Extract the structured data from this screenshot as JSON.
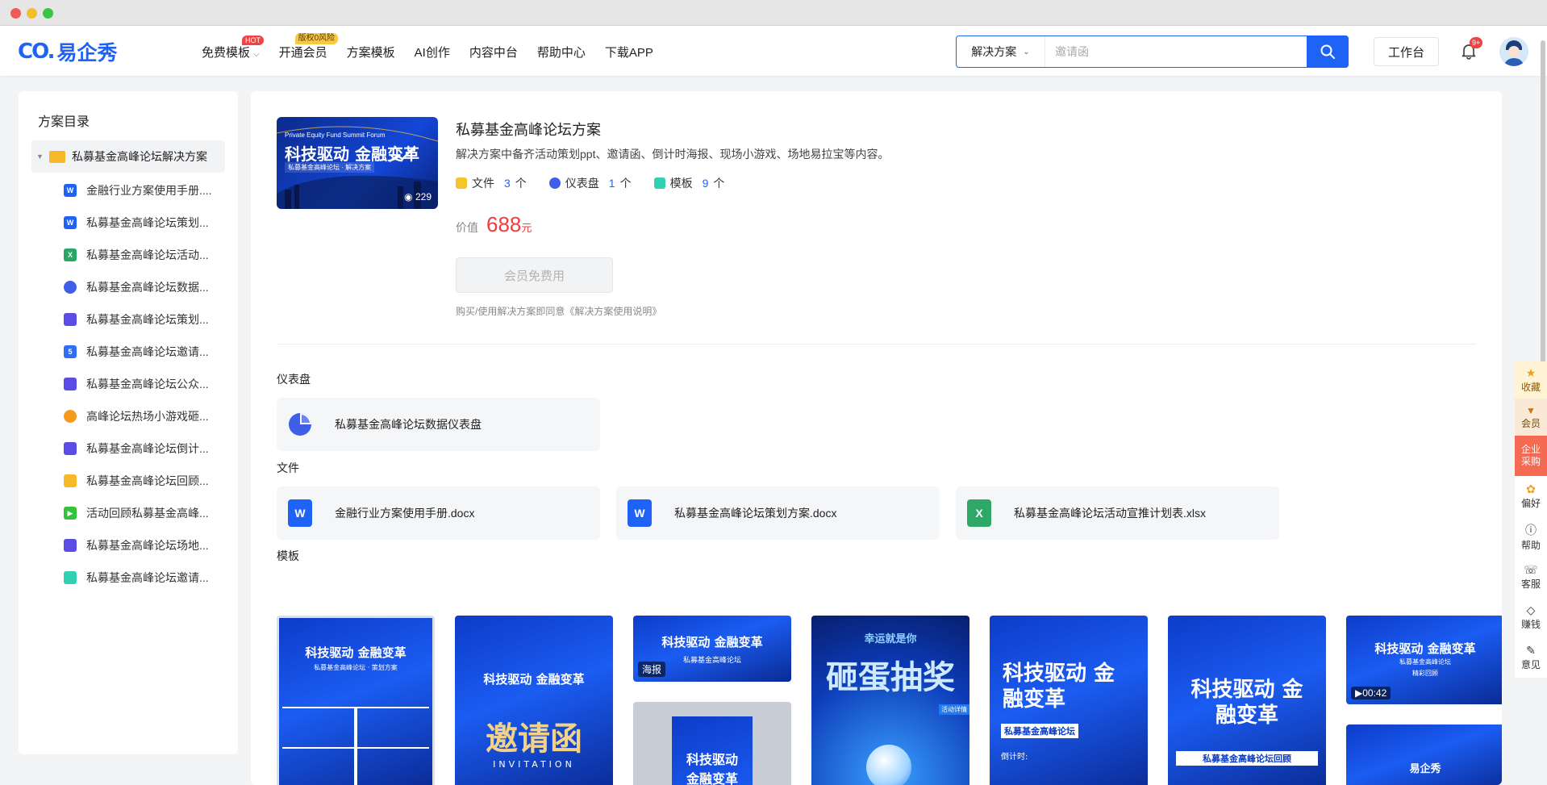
{
  "header": {
    "logo_mark": "CO.",
    "logo_text": "易企秀",
    "nav": [
      {
        "label": "免费模板",
        "badge": "HOT",
        "has_dropdown": true
      },
      {
        "label": "开通会员",
        "badge": "版权0风险"
      },
      {
        "label": "方案模板"
      },
      {
        "label": "AI创作"
      },
      {
        "label": "内容中台"
      },
      {
        "label": "帮助中心"
      },
      {
        "label": "下载APP"
      }
    ],
    "search": {
      "type_label": "解决方案",
      "placeholder": "邀请函"
    },
    "workbench_label": "工作台",
    "notification_badge": "9+"
  },
  "sidebar": {
    "title": "方案目录",
    "root": "私募基金高峰论坛解决方案",
    "items": [
      {
        "label": "金融行业方案使用手册....",
        "icon": "word-icon",
        "color": "#1e63f5"
      },
      {
        "label": "私募基金高峰论坛策划...",
        "icon": "word-icon",
        "color": "#1e63f5"
      },
      {
        "label": "私募基金高峰论坛活动...",
        "icon": "excel-icon",
        "color": "#27a866"
      },
      {
        "label": "私募基金高峰论坛数据...",
        "icon": "dashboard-icon",
        "color": "#3f5fe8"
      },
      {
        "label": "私募基金高峰论坛策划...",
        "icon": "book-icon",
        "color": "#5b4ce6"
      },
      {
        "label": "私募基金高峰论坛邀请...",
        "icon": "h5-icon",
        "color": "#2f6ef5"
      },
      {
        "label": "私募基金高峰论坛公众...",
        "icon": "image-icon",
        "color": "#5b4ce6"
      },
      {
        "label": "高峰论坛热场小游戏砸...",
        "icon": "game-icon",
        "color": "#f59a1b"
      },
      {
        "label": "私募基金高峰论坛倒计...",
        "icon": "image-icon",
        "color": "#5b4ce6"
      },
      {
        "label": "私募基金高峰论坛回顾...",
        "icon": "doc-icon",
        "color": "#f7b928"
      },
      {
        "label": "活动回顾私募基金高峰...",
        "icon": "video-icon",
        "color": "#34c33c"
      },
      {
        "label": "私募基金高峰论坛场地...",
        "icon": "image-icon",
        "color": "#5b4ce6"
      },
      {
        "label": "私募基金高峰论坛邀请...",
        "icon": "form-icon",
        "color": "#2fd1b0"
      }
    ]
  },
  "solution": {
    "cover_title": "科技驱动 金融变革",
    "cover_subtitle": "Private Equity Fund Summit Forum",
    "cover_tag": "私募基金高峰论坛 · 解决方案",
    "views": "229",
    "title": "私募基金高峰论坛方案",
    "description": "解决方案中备齐活动策划ppt、邀请函、倒计时海报、现场小游戏、场地易拉宝等内容。",
    "stats": [
      {
        "label": "文件",
        "count": "3",
        "unit": "个",
        "color": "#f7c52b"
      },
      {
        "label": "仪表盘",
        "count": "1",
        "unit": "个",
        "color": "#3f5fe8"
      },
      {
        "label": "模板",
        "count": "9",
        "unit": "个",
        "color": "#2fd1b0"
      }
    ],
    "price_label": "价值",
    "price": "688",
    "price_unit": "元",
    "free_button": "会员免费用",
    "agreement": "购买/使用解决方案即同意《解决方案使用说明》"
  },
  "dashboard_section": {
    "title": "仪表盘",
    "items": [
      {
        "label": "私募基金高峰论坛数据仪表盘"
      }
    ]
  },
  "files_section": {
    "title": "文件",
    "items": [
      {
        "label": "金融行业方案使用手册.docx",
        "icon": "word-icon",
        "letter": "W",
        "color": "#1e63f5"
      },
      {
        "label": "私募基金高峰论坛策划方案.docx",
        "icon": "word-icon",
        "letter": "W",
        "color": "#1e63f5"
      },
      {
        "label": "私募基金高峰论坛活动宣推计划表.xlsx",
        "icon": "excel-icon",
        "letter": "X",
        "color": "#2da866"
      }
    ]
  },
  "templates_section": {
    "title": "模板",
    "items": [
      {
        "title": "科技驱动 金融变革",
        "sub": "私募基金高峰论坛 · 策划方案"
      },
      {
        "title": "科技驱动 金融变革",
        "sub": "邀请函",
        "extra": "INVITATION"
      },
      {
        "title": "科技驱动 金融变革",
        "sub": "私募基金高峰论坛",
        "label": "海报"
      },
      {
        "title": "科技驱动",
        "sub": "金融变革"
      },
      {
        "title": "砸蛋抽奖",
        "sub": "幸运就是你",
        "extra": "活动详情"
      },
      {
        "title": "科技驱动 金融变革",
        "sub": "私募基金高峰论坛",
        "extra": "倒计时:"
      },
      {
        "title": "科技驱动 金融变革",
        "sub": "私募基金高峰论坛回顾"
      },
      {
        "title": "科技驱动 金融变革",
        "sub": "私募基金高峰论坛",
        "extra": "精彩回顾",
        "label": "00:42"
      },
      {
        "title": "易企秀",
        "sub": ""
      }
    ]
  },
  "rail": [
    {
      "label": "收藏",
      "icon": "star-icon"
    },
    {
      "label": "会员",
      "icon": "vip-icon"
    },
    {
      "label": "企业采购",
      "icon": "enterprise-icon"
    },
    {
      "label": "偏好",
      "icon": "preference-icon"
    },
    {
      "label": "帮助",
      "icon": "help-icon"
    },
    {
      "label": "客服",
      "icon": "service-icon"
    },
    {
      "label": "赚钱",
      "icon": "money-icon"
    },
    {
      "label": "意见",
      "icon": "feedback-icon"
    }
  ]
}
